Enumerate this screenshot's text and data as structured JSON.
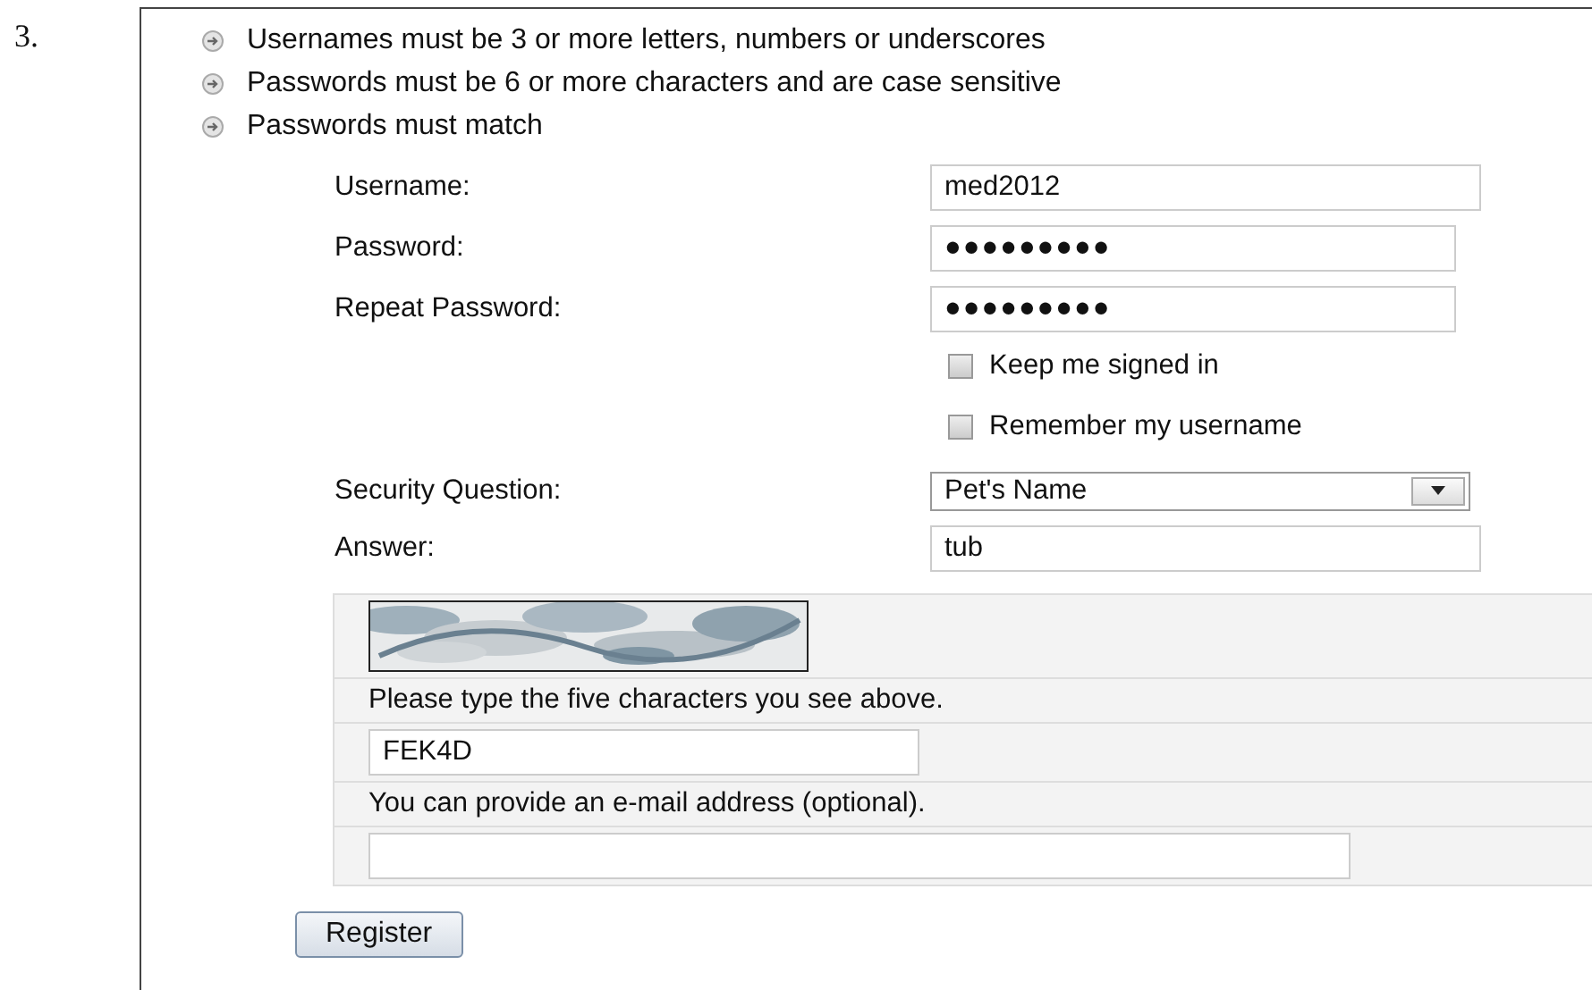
{
  "item_number": "3.",
  "rules": [
    "Usernames must be 3 or more letters, numbers or underscores",
    "Passwords must be 6 or more characters and are case sensitive",
    "Passwords must match"
  ],
  "fields": [
    {
      "kind": "text",
      "label": "Username:",
      "value": "med2012"
    },
    {
      "kind": "password",
      "label": "Password:",
      "value": "●●●●●●●●●"
    },
    {
      "kind": "password",
      "label": "Repeat Password:",
      "value": "●●●●●●●●●"
    }
  ],
  "options": [
    {
      "label": "Keep me signed in",
      "checked": false
    },
    {
      "label": "Remember my username",
      "checked": false
    }
  ],
  "security_question": {
    "label": "Security Question:",
    "value": "Pet's Name"
  },
  "answer": {
    "label": "Answer:",
    "value": "tub"
  },
  "captcha": {
    "prompt": "Please type the five characters you see above.",
    "value": "FEK4D"
  },
  "email": {
    "prompt": "You can provide an e-mail address (optional)."
  },
  "register_button": "Register"
}
